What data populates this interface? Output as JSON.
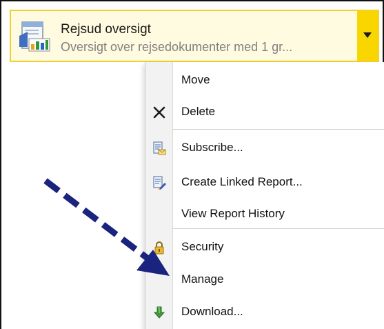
{
  "report": {
    "title": "Rejsud oversigt",
    "description": "Oversigt over rejsedokumenter med 1 gr...",
    "icon": "report-chart-icon"
  },
  "menu": {
    "items": [
      {
        "label": "Move",
        "icon": ""
      },
      {
        "label": "Delete",
        "icon": "close-icon"
      },
      {
        "label": "Subscribe...",
        "icon": "subscribe-icon"
      },
      {
        "label": "Create Linked Report...",
        "icon": "linked-report-icon"
      },
      {
        "label": "View Report History",
        "icon": ""
      },
      {
        "label": "Security",
        "icon": "lock-icon"
      },
      {
        "label": "Manage",
        "icon": ""
      },
      {
        "label": "Download...",
        "icon": "download-icon"
      }
    ]
  },
  "colors": {
    "tile_background": "#fffbe0",
    "tile_border": "#f3cf2a",
    "dropdown_button": "#fad600",
    "annotation_arrow": "#1a237e"
  }
}
